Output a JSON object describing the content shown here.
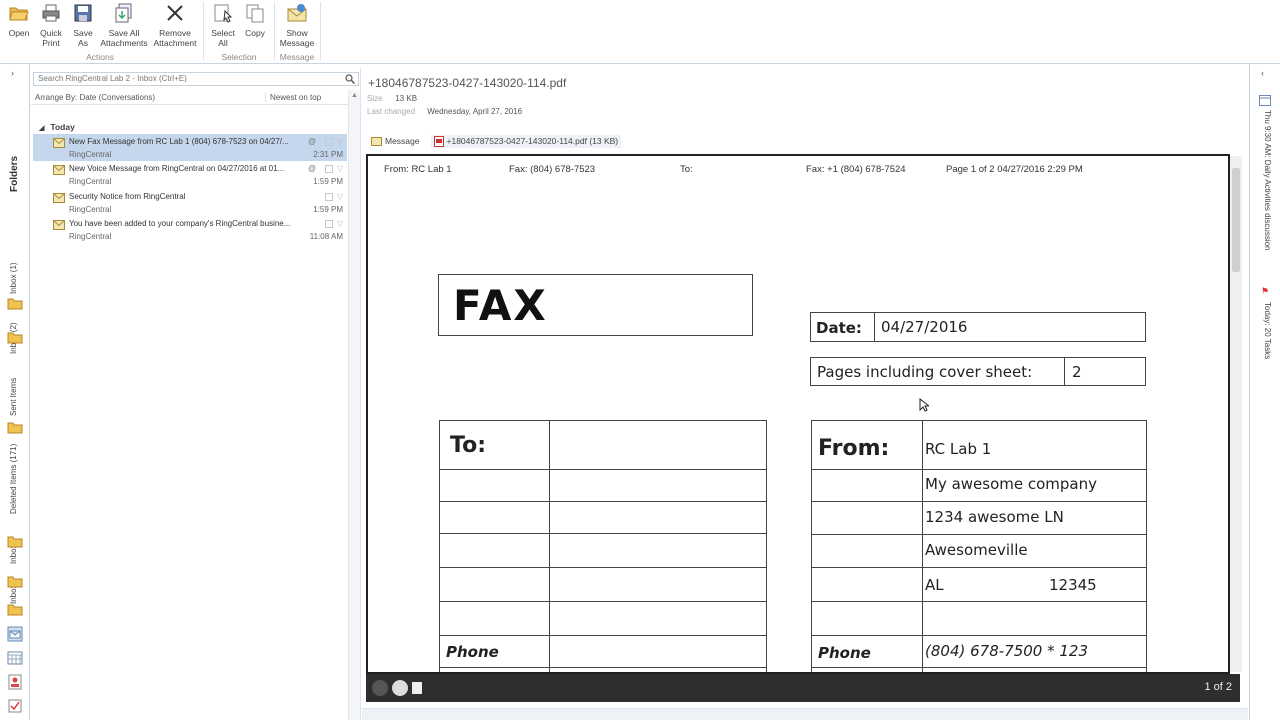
{
  "ribbon": {
    "buttons": [
      {
        "label": "Open",
        "icon": "folder-open-icon"
      },
      {
        "label": "Quick\nPrint",
        "icon": "printer-icon"
      },
      {
        "label": "Save\nAs",
        "icon": "save-icon"
      },
      {
        "label": "Save All\nAttachments",
        "icon": "save-all-icon"
      },
      {
        "label": "Remove\nAttachment",
        "icon": "remove-x-icon"
      },
      {
        "label": "Select\nAll",
        "icon": "select-all-icon"
      },
      {
        "label": "Copy",
        "icon": "copy-icon"
      },
      {
        "label": "Show\nMessage",
        "icon": "envelope-icon"
      }
    ],
    "groups": {
      "actions": "Actions",
      "selection": "Selection",
      "message": "Message"
    }
  },
  "nav": {
    "folders_label": "Folders",
    "items": [
      "Inbox (1)",
      "Inbox (2)",
      "Sent Items",
      "Deleted Items (171)",
      "Inbox",
      "Inbox"
    ]
  },
  "list": {
    "search_placeholder": "Search RingCentral Lab 2 - Inbox (Ctrl+E)",
    "arrange_by": "Arrange By: Date (Conversations)",
    "sort": "Newest on top",
    "group_today": "Today",
    "messages": [
      {
        "subject": "New Fax Message from RC Lab 1 (804) 678-7523 on 04/27/...",
        "from": "RingCentral",
        "time": "2:31 PM",
        "attachment": true,
        "selected": true
      },
      {
        "subject": "New Voice Message from RingCentral on 04/27/2016 at 01...",
        "from": "RingCentral",
        "time": "1:59 PM",
        "attachment": true,
        "selected": false
      },
      {
        "subject": "Security Notice from RingCentral",
        "from": "RingCentral",
        "time": "1:59 PM",
        "attachment": false,
        "selected": false
      },
      {
        "subject": "You have been added to your company's RingCentral busine...",
        "from": "RingCentral",
        "time": "11:08 AM",
        "attachment": false,
        "selected": false
      }
    ]
  },
  "reading": {
    "filename": "+18046787523-0427-143020-114.pdf",
    "size_label": "Size",
    "size": "13 KB",
    "changed_label": "Last changed",
    "changed": "Wednesday, April 27, 2016",
    "tab_message": "Message",
    "tab_attachment": "+18046787523-0427-143020-114.pdf (13 KB)",
    "page_indicator": "1 of 2"
  },
  "fax": {
    "header_from": "From: RC Lab 1",
    "header_fax": "Fax: (804) 678-7523",
    "header_to": "To:",
    "header_fax2": "Fax: +1 (804) 678-7524",
    "header_page": "Page  1  of  2  04/27/2016 2:29 PM",
    "title": "FAX",
    "date_label": "Date:",
    "date_value": "04/27/2016",
    "pages_label": "Pages including cover  sheet:",
    "pages_value": "2",
    "to_label": "To:",
    "from_label": "From:",
    "from_lines": [
      "RC Lab 1",
      "My awesome company",
      "1234 awesome LN",
      "Awesomeville"
    ],
    "state": "AL",
    "zip": "12345",
    "phone_label": "Phone",
    "phone_value": "(804) 678-7500 * 123"
  },
  "todo": {
    "appointment": "Thu 9:30 AM: Daily Activities discussion",
    "tasks": "Today: 20 Tasks"
  }
}
